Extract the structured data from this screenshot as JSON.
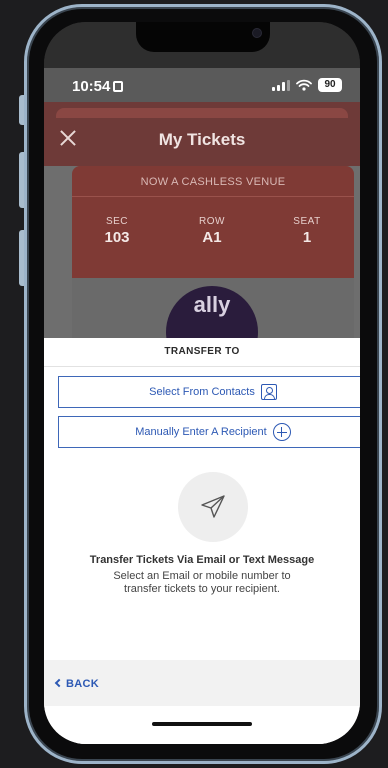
{
  "status_bar": {
    "time": "10:54",
    "battery": "90"
  },
  "header": {
    "title": "My Tickets"
  },
  "ticket": {
    "banner": "NOW A CASHLESS VENUE",
    "columns": [
      {
        "label": "SEC",
        "value": "103"
      },
      {
        "label": "ROW",
        "value": "A1"
      },
      {
        "label": "SEAT",
        "value": "1"
      }
    ],
    "logo_text": "ally"
  },
  "sheet": {
    "title": "TRANSFER TO",
    "select_contacts_label": "Select From Contacts",
    "manual_recipient_label": "Manually Enter A Recipient",
    "empty_title": "Transfer Tickets Via Email or Text Message",
    "empty_description": "Select an Email or mobile number to transfer tickets to your recipient.",
    "back_label": "BACK"
  },
  "colors": {
    "accent_blue": "#2d59b4",
    "ticket_red": "#7f3a35",
    "frame": "#9db4c9"
  },
  "icons": [
    "close-icon",
    "contacts-icon",
    "plus-circle-icon",
    "paper-plane-icon",
    "chevron-left-icon",
    "signal-icon",
    "wifi-icon",
    "battery-icon"
  ]
}
